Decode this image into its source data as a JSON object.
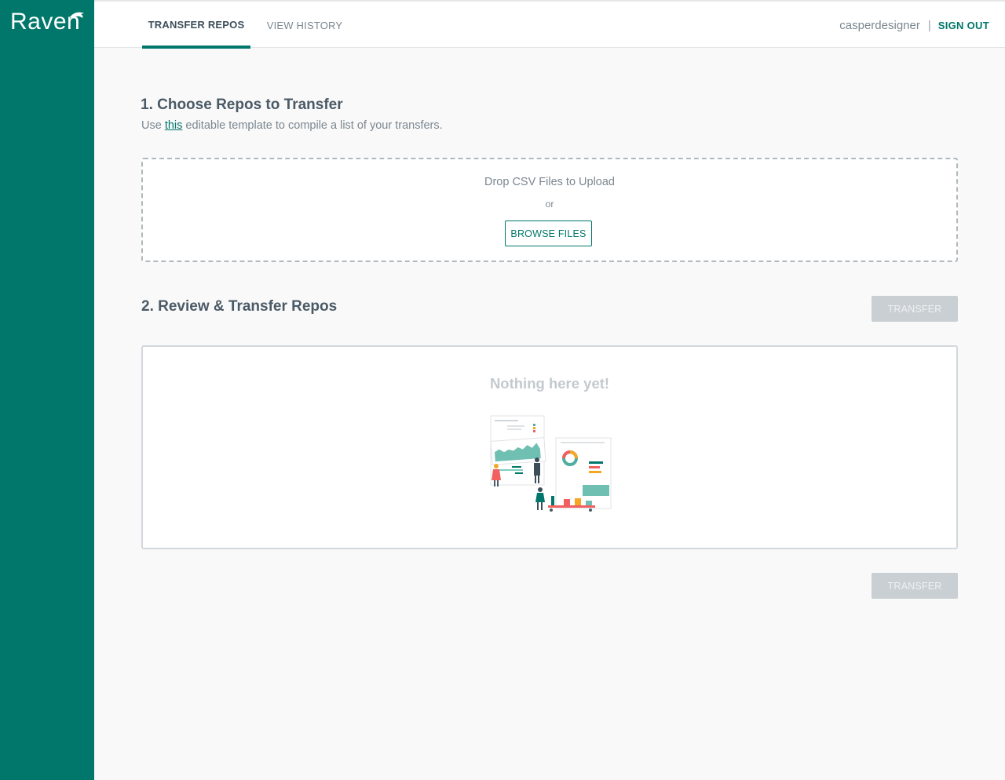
{
  "app": {
    "logo_text": "Raven"
  },
  "nav": {
    "tabs": [
      {
        "label": "TRANSFER REPOS",
        "active": true
      },
      {
        "label": "VIEW HISTORY",
        "active": false
      }
    ],
    "username": "casperdesigner",
    "separator": "|",
    "sign_out_label": "SIGN OUT"
  },
  "section1": {
    "title": "1. Choose Repos to Transfer",
    "desc_before": "Use ",
    "desc_link": "this",
    "desc_after": " editable template to compile a list of your transfers.",
    "dropzone": {
      "title": "Drop CSV Files to Upload",
      "or": "or",
      "browse_label": "BROWSE FILES"
    }
  },
  "section2": {
    "title": "2. Review & Transfer Repos",
    "transfer_label": "TRANSFER",
    "empty_text": "Nothing here yet!"
  },
  "colors": {
    "brand": "#00776a",
    "disabled_button": "#c9cfd3",
    "accent_red": "#f06060",
    "accent_orange": "#f5a623"
  },
  "icons": {
    "logo_mark": "raven-bird-icon",
    "empty_state": "dashboard-team-illustration"
  }
}
